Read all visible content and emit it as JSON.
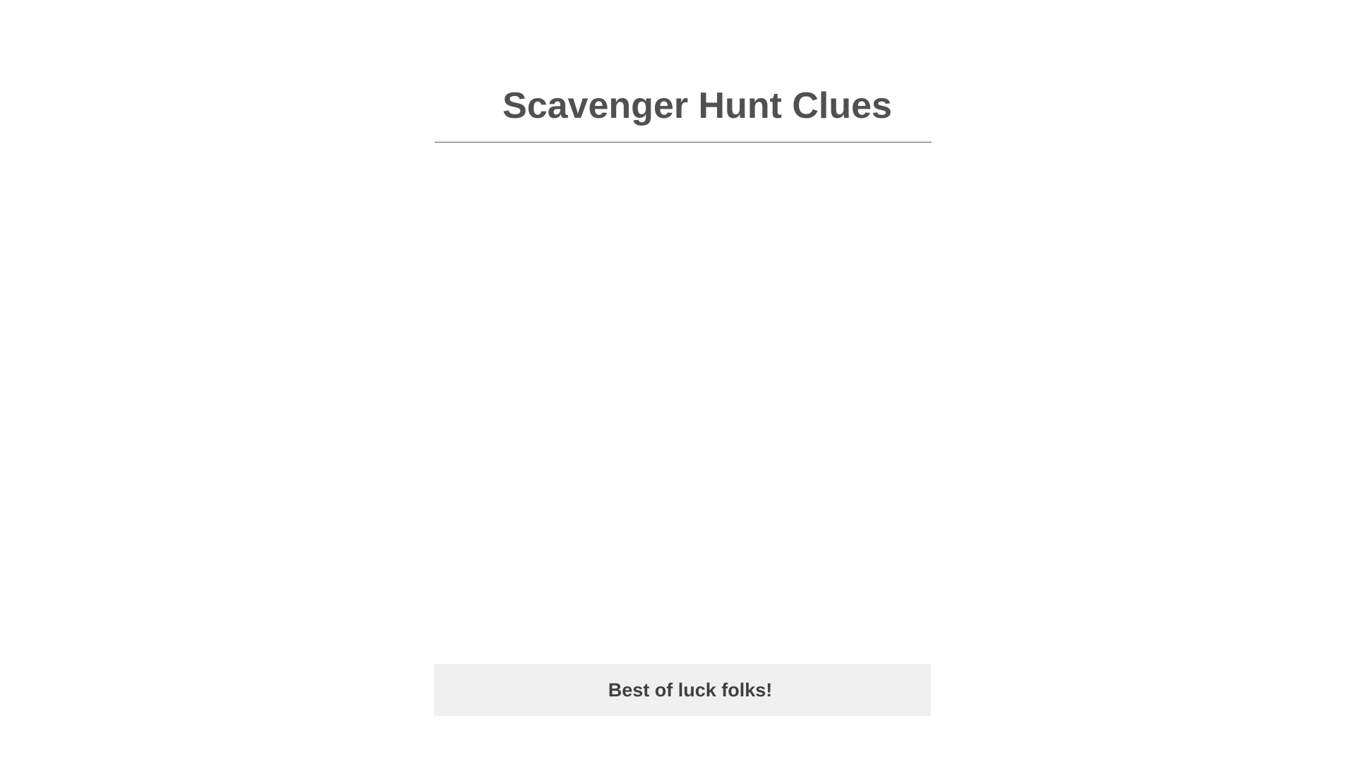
{
  "header": {
    "title": "Scavenger Hunt Clues"
  },
  "footer": {
    "message": "Best of luck folks!"
  },
  "colors": {
    "title_text": "#505050",
    "divider": "#555555",
    "footer_background": "#f0f0f0",
    "footer_text": "#404040",
    "page_background": "#ffffff"
  }
}
